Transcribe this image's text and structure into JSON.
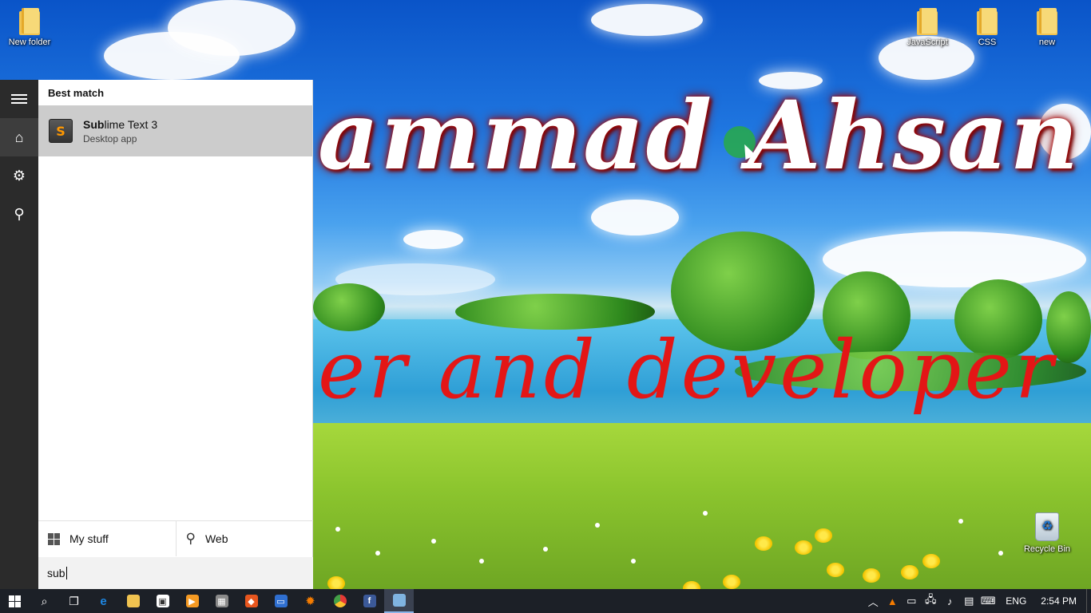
{
  "desktop": {
    "icons": [
      {
        "label": "New folder"
      },
      {
        "label": "JavaScript"
      },
      {
        "label": "CSS"
      },
      {
        "label": "new"
      },
      {
        "label": "Recycle Bin"
      }
    ],
    "wallpaper": {
      "title_text": "ammad Ahsan",
      "subtitle_text": "er and developer"
    }
  },
  "start_menu": {
    "section_label": "Best match",
    "result": {
      "name_match": "Sub",
      "name_rest": "lime Text 3",
      "type": "Desktop app",
      "icon_letter": "S"
    },
    "scopes": [
      {
        "label": "My stuff",
        "icon": "windows-icon"
      },
      {
        "label": "Web",
        "icon": "search-icon"
      }
    ],
    "search_query": "sub"
  },
  "taskbar": {
    "apps": [
      {
        "icon": "search-icon",
        "glyph": "⌕"
      },
      {
        "icon": "task-view-icon",
        "glyph": "❐"
      },
      {
        "icon": "edge-icon",
        "glyph": "e",
        "color": "#1e88e5"
      },
      {
        "icon": "file-explorer-icon",
        "glyph": "▤",
        "color": "#f0c350"
      },
      {
        "icon": "store-icon",
        "glyph": "▣",
        "color": "#ffffff"
      },
      {
        "icon": "media-player-icon",
        "glyph": "▶",
        "color": "#f59a23"
      },
      {
        "icon": "movie-maker-icon",
        "glyph": "▦",
        "color": "#9e9e9e"
      },
      {
        "icon": "fox-app-icon",
        "glyph": "◆",
        "color": "#e8561e"
      },
      {
        "icon": "id-card-app-icon",
        "glyph": "▭",
        "color": "#2f6fd0"
      },
      {
        "icon": "paint-app-icon",
        "glyph": "✹",
        "color": "#f57c00"
      },
      {
        "icon": "chrome-icon",
        "glyph": "◉",
        "color": "#e53935"
      },
      {
        "icon": "facebook-icon",
        "glyph": "f",
        "color": "#3b5998"
      },
      {
        "icon": "notepad-icon",
        "glyph": "▥",
        "color": "#7fb3e0"
      }
    ],
    "language": "ENG",
    "time": "2:54 PM"
  }
}
